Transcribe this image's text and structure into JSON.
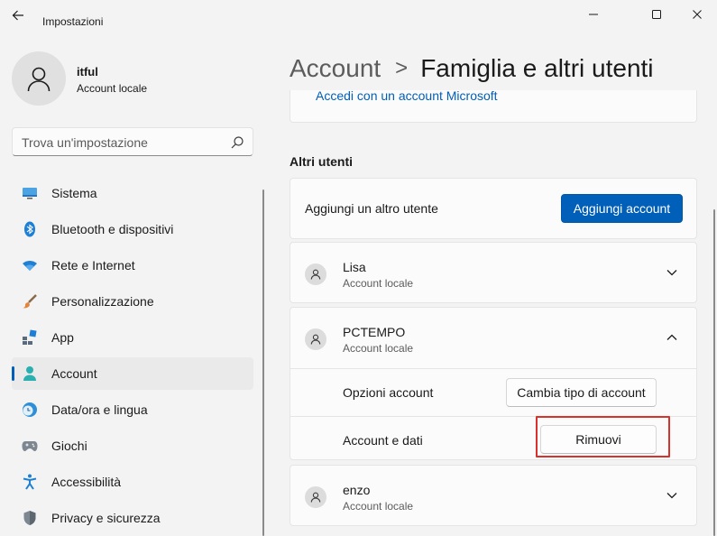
{
  "window": {
    "title": "Impostazioni"
  },
  "profile": {
    "name": "itful",
    "type": "Account locale"
  },
  "search": {
    "placeholder": "Trova un'impostazione"
  },
  "nav": [
    {
      "label": "Sistema",
      "icon": "monitor-icon",
      "active": false
    },
    {
      "label": "Bluetooth e dispositivi",
      "icon": "bluetooth-icon",
      "active": false
    },
    {
      "label": "Rete e Internet",
      "icon": "wifi-icon",
      "active": false
    },
    {
      "label": "Personalizzazione",
      "icon": "brush-icon",
      "active": false
    },
    {
      "label": "App",
      "icon": "apps-icon",
      "active": false
    },
    {
      "label": "Account",
      "icon": "person-icon",
      "active": true
    },
    {
      "label": "Data/ora e lingua",
      "icon": "clock-globe-icon",
      "active": false
    },
    {
      "label": "Giochi",
      "icon": "gamepad-icon",
      "active": false
    },
    {
      "label": "Accessibilità",
      "icon": "accessibility-icon",
      "active": false
    },
    {
      "label": "Privacy e sicurezza",
      "icon": "shield-icon",
      "active": false
    }
  ],
  "breadcrumb": {
    "parent": "Account",
    "separator": ">",
    "current": "Famiglia e altri utenti"
  },
  "top_card": {
    "link": "Accedi con un account Microsoft"
  },
  "other_users": {
    "title": "Altri utenti",
    "add_label": "Aggiungi un altro utente",
    "add_button": "Aggiungi account",
    "users": [
      {
        "name": "Lisa",
        "type": "Account locale",
        "expanded": false
      },
      {
        "name": "PCTEMPO",
        "type": "Account locale",
        "expanded": true
      },
      {
        "name": "enzo",
        "type": "Account locale",
        "expanded": false
      }
    ],
    "expanded_options": {
      "options_label": "Opzioni account",
      "change_type_button": "Cambia tipo di account",
      "data_label": "Account e dati",
      "remove_button": "Rimuovi"
    }
  },
  "colors": {
    "accent": "#005fb8",
    "highlight": "#d9312b",
    "background": "#f3f3f3",
    "card": "#fbfbfb"
  }
}
